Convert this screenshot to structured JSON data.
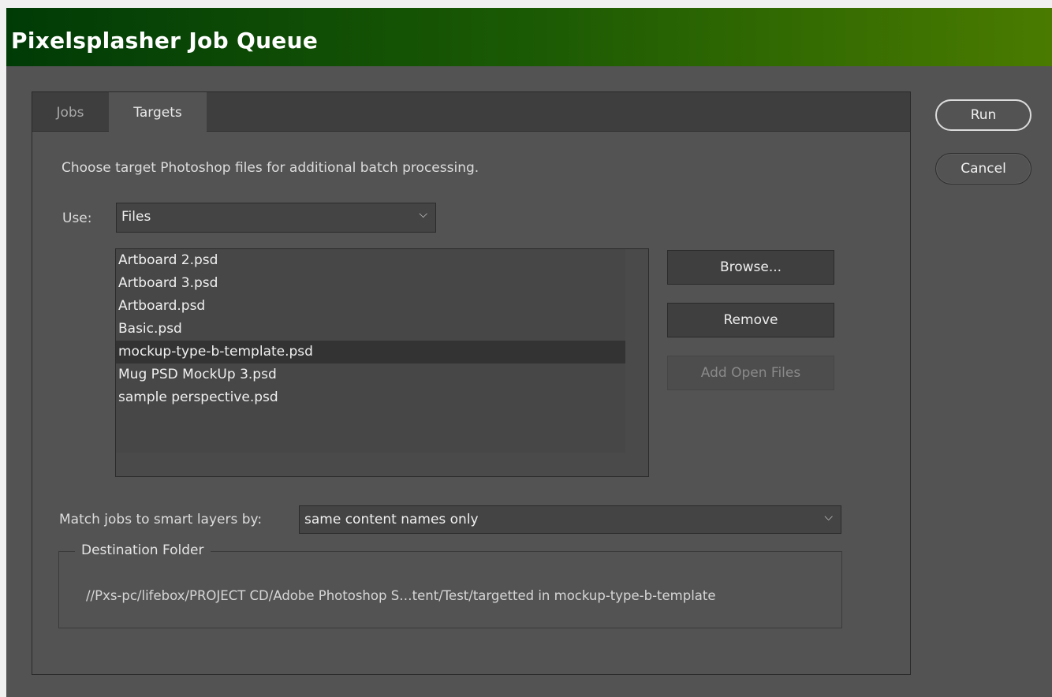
{
  "window": {
    "title": "Pixelsplasher Job Queue"
  },
  "tabs": [
    {
      "label": "Jobs",
      "active": false
    },
    {
      "label": "Targets",
      "active": true
    }
  ],
  "targets": {
    "description": "Choose target Photoshop files for additional batch processing.",
    "use_label": "Use:",
    "use_value": "Files",
    "files": [
      "Artboard 2.psd",
      "Artboard 3.psd",
      "Artboard.psd",
      "Basic.psd",
      "mockup-type-b-template.psd",
      "Mug PSD MockUp 3.psd",
      "sample perspective.psd"
    ],
    "selected_file": "mockup-type-b-template.psd",
    "buttons": {
      "browse": "Browse...",
      "remove": "Remove",
      "add_open_files": "Add Open Files"
    },
    "match_label": "Match jobs to smart layers by:",
    "match_value": "same content names only",
    "destination": {
      "legend": "Destination Folder",
      "path": "//Pxs-pc/lifebox/PROJECT CD/Adobe Photoshop S…tent/Test/targetted in mockup-type-b-template"
    }
  },
  "actions": {
    "run": "Run",
    "cancel": "Cancel"
  },
  "icons": {
    "dropdown": "chevron-down-icon"
  },
  "colors": {
    "title_start": "#003b06",
    "title_end": "#4a7b00",
    "background": "#535353"
  }
}
